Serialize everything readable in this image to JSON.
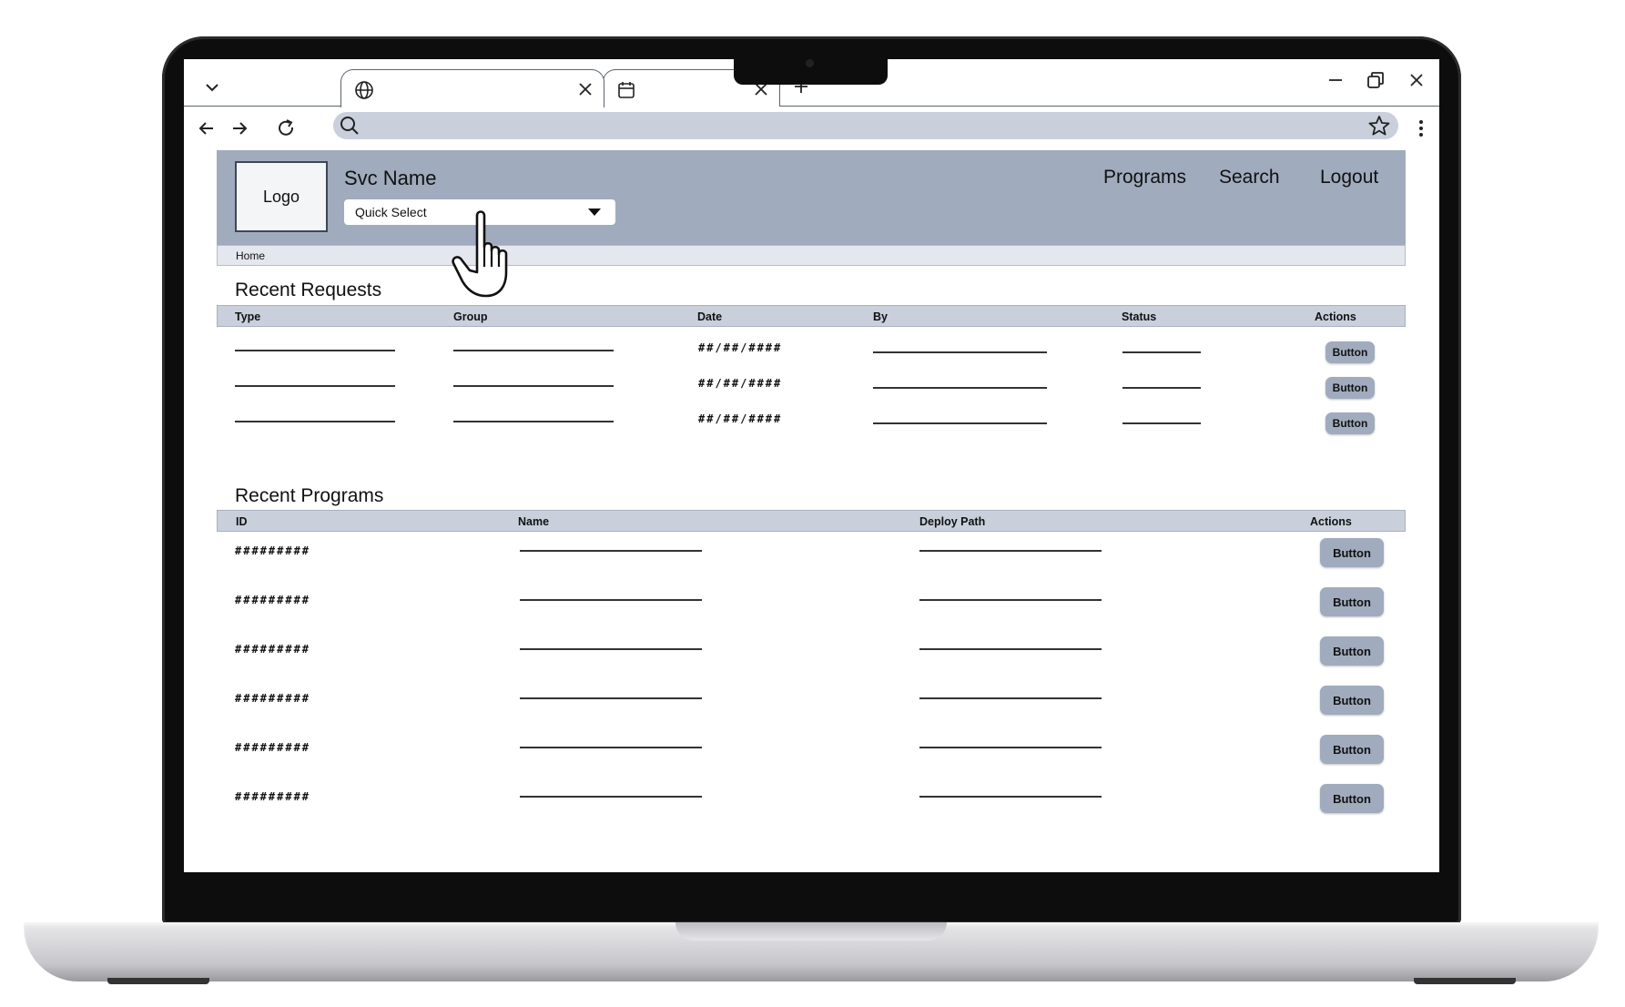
{
  "browser": {
    "tabs": [
      {
        "icon": "globe-icon"
      },
      {
        "icon": "calendar-icon"
      }
    ]
  },
  "header": {
    "logo_label": "Logo",
    "service_name": "Svc Name",
    "quick_select": {
      "value": "Quick Select"
    },
    "nav": [
      "Programs",
      "Search",
      "Logout"
    ]
  },
  "breadcrumb": "Home",
  "recent_requests": {
    "title": "Recent Requests",
    "columns": [
      "Type",
      "Group",
      "Date",
      "By",
      "Status",
      "Actions"
    ],
    "rows": [
      {
        "date": "##/##/####",
        "action": "Button"
      },
      {
        "date": "##/##/####",
        "action": "Button"
      },
      {
        "date": "##/##/####",
        "action": "Button"
      }
    ]
  },
  "recent_programs": {
    "title": "Recent Programs",
    "columns": [
      "ID",
      "Name",
      "Deploy Path",
      "Actions"
    ],
    "rows": [
      {
        "id": "#########",
        "action": "Button"
      },
      {
        "id": "#########",
        "action": "Button"
      },
      {
        "id": "#########",
        "action": "Button"
      },
      {
        "id": "#########",
        "action": "Button"
      },
      {
        "id": "#########",
        "action": "Button"
      },
      {
        "id": "#########",
        "action": "Button"
      }
    ]
  },
  "colors": {
    "header_bg": "#a0abbd",
    "table_header_bg": "#c9d0dc",
    "button_bg": "#a0abbd"
  }
}
